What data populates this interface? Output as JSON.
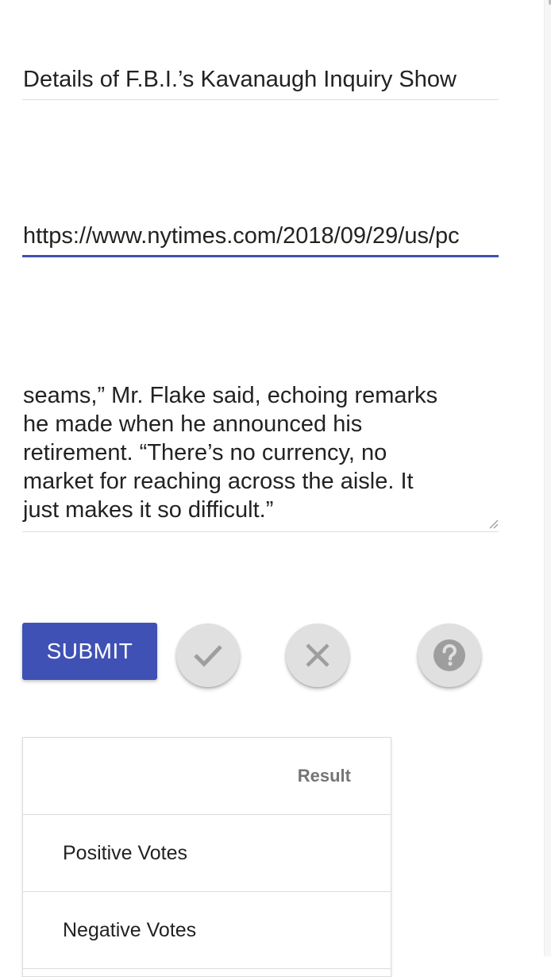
{
  "form": {
    "title_value": "Details of F.B.I.’s Kavanaugh Inquiry Show",
    "url_value": "https://www.nytimes.com/2018/09/29/us/pc",
    "body_lines": [
      "seams,” Mr. Flake said, echoing remarks",
      "he made when he announced his",
      "retirement. “There’s no currency, no",
      "market for reaching across the aisle. It",
      "just makes it so difficult.”"
    ]
  },
  "actions": {
    "submit_label": "SUBMIT",
    "approve_icon": "check-icon",
    "reject_icon": "close-icon",
    "help_icon": "help-icon"
  },
  "results": {
    "header": "Result",
    "rows": [
      {
        "label": "Positive Votes",
        "value": ""
      },
      {
        "label": "Negative Votes",
        "value": ""
      }
    ]
  },
  "colors": {
    "accent": "#3f51b5",
    "fab_background": "#e0e0e0",
    "icon_grey": "#9e9e9e"
  }
}
